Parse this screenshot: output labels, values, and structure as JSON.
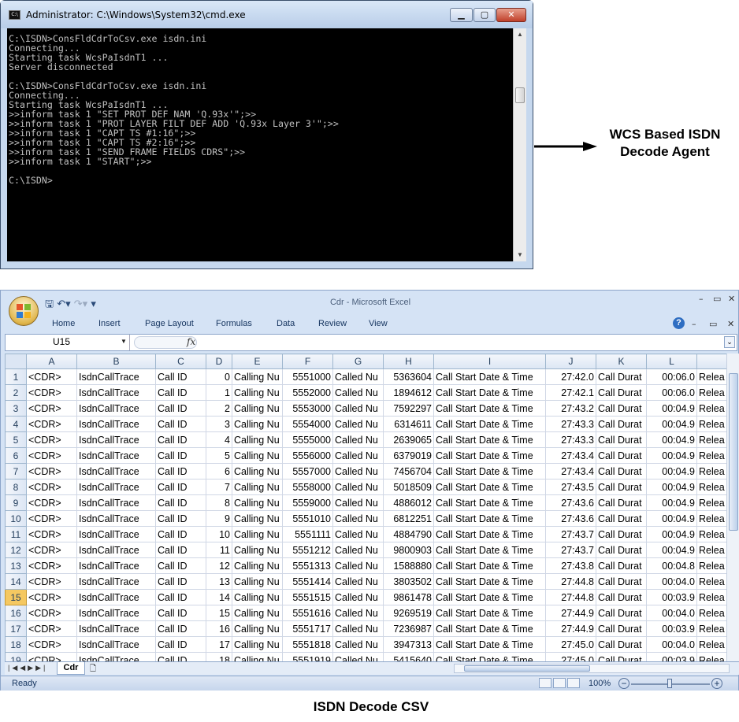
{
  "cmd": {
    "title": "Administrator: C:\\Windows\\System32\\cmd.exe",
    "icon": "cmd-icon",
    "lines": [
      "C:\\ISDN>ConsFldCdrToCsv.exe isdn.ini",
      "Connecting...",
      "Starting task WcsPaIsdnT1 ...",
      "Server disconnected",
      "",
      "C:\\ISDN>ConsFldCdrToCsv.exe isdn.ini",
      "Connecting...",
      "Starting task WcsPaIsdnT1 ...",
      ">>inform task 1 \"SET PROT DEF NAM 'Q.93x'\";>>",
      ">>inform task 1 \"PROT LAYER FILT DEF ADD 'Q.93x Layer 3'\";>>",
      ">>inform task 1 \"CAPT TS #1:16\";>>",
      ">>inform task 1 \"CAPT TS #2:16\";>>",
      ">>inform task 1 \"SEND FRAME FIELDS CDRS\";>>",
      ">>inform task 1 \"START\";>>",
      "",
      "C:\\ISDN>"
    ]
  },
  "agent_label_line1": "WCS Based ISDN",
  "agent_label_line2": "Decode Agent",
  "excel": {
    "title": "Cdr - Microsoft Excel",
    "tabs": [
      "Home",
      "Insert",
      "Page Layout",
      "Formulas",
      "Data",
      "Review",
      "View"
    ],
    "name_box": "U15",
    "fx": "fx",
    "columns": [
      "A",
      "B",
      "C",
      "D",
      "E",
      "F",
      "G",
      "H",
      "I",
      "J",
      "K",
      "L",
      ""
    ],
    "rows": [
      [
        "1",
        "<CDR>",
        "IsdnCallTrace",
        "Call ID",
        "0",
        "Calling Nu",
        "5551000",
        "Called Nu",
        "5363604",
        "Call Start Date & Time",
        "27:42.0",
        "Call Durat",
        "00:06.0",
        "Relea"
      ],
      [
        "2",
        "<CDR>",
        "IsdnCallTrace",
        "Call ID",
        "1",
        "Calling Nu",
        "5552000",
        "Called Nu",
        "1894612",
        "Call Start Date & Time",
        "27:42.1",
        "Call Durat",
        "00:06.0",
        "Relea"
      ],
      [
        "3",
        "<CDR>",
        "IsdnCallTrace",
        "Call ID",
        "2",
        "Calling Nu",
        "5553000",
        "Called Nu",
        "7592297",
        "Call Start Date & Time",
        "27:43.2",
        "Call Durat",
        "00:04.9",
        "Relea"
      ],
      [
        "4",
        "<CDR>",
        "IsdnCallTrace",
        "Call ID",
        "3",
        "Calling Nu",
        "5554000",
        "Called Nu",
        "6314611",
        "Call Start Date & Time",
        "27:43.3",
        "Call Durat",
        "00:04.9",
        "Relea"
      ],
      [
        "5",
        "<CDR>",
        "IsdnCallTrace",
        "Call ID",
        "4",
        "Calling Nu",
        "5555000",
        "Called Nu",
        "2639065",
        "Call Start Date & Time",
        "27:43.3",
        "Call Durat",
        "00:04.9",
        "Relea"
      ],
      [
        "6",
        "<CDR>",
        "IsdnCallTrace",
        "Call ID",
        "5",
        "Calling Nu",
        "5556000",
        "Called Nu",
        "6379019",
        "Call Start Date & Time",
        "27:43.4",
        "Call Durat",
        "00:04.9",
        "Relea"
      ],
      [
        "7",
        "<CDR>",
        "IsdnCallTrace",
        "Call ID",
        "6",
        "Calling Nu",
        "5557000",
        "Called Nu",
        "7456704",
        "Call Start Date & Time",
        "27:43.4",
        "Call Durat",
        "00:04.9",
        "Relea"
      ],
      [
        "8",
        "<CDR>",
        "IsdnCallTrace",
        "Call ID",
        "7",
        "Calling Nu",
        "5558000",
        "Called Nu",
        "5018509",
        "Call Start Date & Time",
        "27:43.5",
        "Call Durat",
        "00:04.9",
        "Relea"
      ],
      [
        "9",
        "<CDR>",
        "IsdnCallTrace",
        "Call ID",
        "8",
        "Calling Nu",
        "5559000",
        "Called Nu",
        "4886012",
        "Call Start Date & Time",
        "27:43.6",
        "Call Durat",
        "00:04.9",
        "Relea"
      ],
      [
        "10",
        "<CDR>",
        "IsdnCallTrace",
        "Call ID",
        "9",
        "Calling Nu",
        "5551010",
        "Called Nu",
        "6812251",
        "Call Start Date & Time",
        "27:43.6",
        "Call Durat",
        "00:04.9",
        "Relea"
      ],
      [
        "11",
        "<CDR>",
        "IsdnCallTrace",
        "Call ID",
        "10",
        "Calling Nu",
        "5551111",
        "Called Nu",
        "4884790",
        "Call Start Date & Time",
        "27:43.7",
        "Call Durat",
        "00:04.9",
        "Relea"
      ],
      [
        "12",
        "<CDR>",
        "IsdnCallTrace",
        "Call ID",
        "11",
        "Calling Nu",
        "5551212",
        "Called Nu",
        "9800903",
        "Call Start Date & Time",
        "27:43.7",
        "Call Durat",
        "00:04.9",
        "Relea"
      ],
      [
        "13",
        "<CDR>",
        "IsdnCallTrace",
        "Call ID",
        "12",
        "Calling Nu",
        "5551313",
        "Called Nu",
        "1588880",
        "Call Start Date & Time",
        "27:43.8",
        "Call Durat",
        "00:04.8",
        "Relea"
      ],
      [
        "14",
        "<CDR>",
        "IsdnCallTrace",
        "Call ID",
        "13",
        "Calling Nu",
        "5551414",
        "Called Nu",
        "3803502",
        "Call Start Date & Time",
        "27:44.8",
        "Call Durat",
        "00:04.0",
        "Relea"
      ],
      [
        "15",
        "<CDR>",
        "IsdnCallTrace",
        "Call ID",
        "14",
        "Calling Nu",
        "5551515",
        "Called Nu",
        "9861478",
        "Call Start Date & Time",
        "27:44.8",
        "Call Durat",
        "00:03.9",
        "Relea"
      ],
      [
        "16",
        "<CDR>",
        "IsdnCallTrace",
        "Call ID",
        "15",
        "Calling Nu",
        "5551616",
        "Called Nu",
        "9269519",
        "Call Start Date & Time",
        "27:44.9",
        "Call Durat",
        "00:04.0",
        "Relea"
      ],
      [
        "17",
        "<CDR>",
        "IsdnCallTrace",
        "Call ID",
        "16",
        "Calling Nu",
        "5551717",
        "Called Nu",
        "7236987",
        "Call Start Date & Time",
        "27:44.9",
        "Call Durat",
        "00:03.9",
        "Relea"
      ],
      [
        "18",
        "<CDR>",
        "IsdnCallTrace",
        "Call ID",
        "17",
        "Calling Nu",
        "5551818",
        "Called Nu",
        "3947313",
        "Call Start Date & Time",
        "27:45.0",
        "Call Durat",
        "00:04.0",
        "Relea"
      ],
      [
        "19",
        "<CDR>",
        "IsdnCallTrace",
        "Call ID",
        "18",
        "Calling Nu",
        "5551919",
        "Called Nu",
        "5415640",
        "Call Start Date & Time",
        "27:45.0",
        "Call Durat",
        "00:03.9",
        "Relea"
      ]
    ],
    "selected_row": "15",
    "sheet_tab": "Cdr",
    "status_ready": "Ready",
    "zoom": "100%"
  },
  "caption": "ISDN Decode CSV",
  "colors": {
    "accent": "#f5c861",
    "ribbon": "#d5e3f5",
    "console_bg": "#000000"
  }
}
